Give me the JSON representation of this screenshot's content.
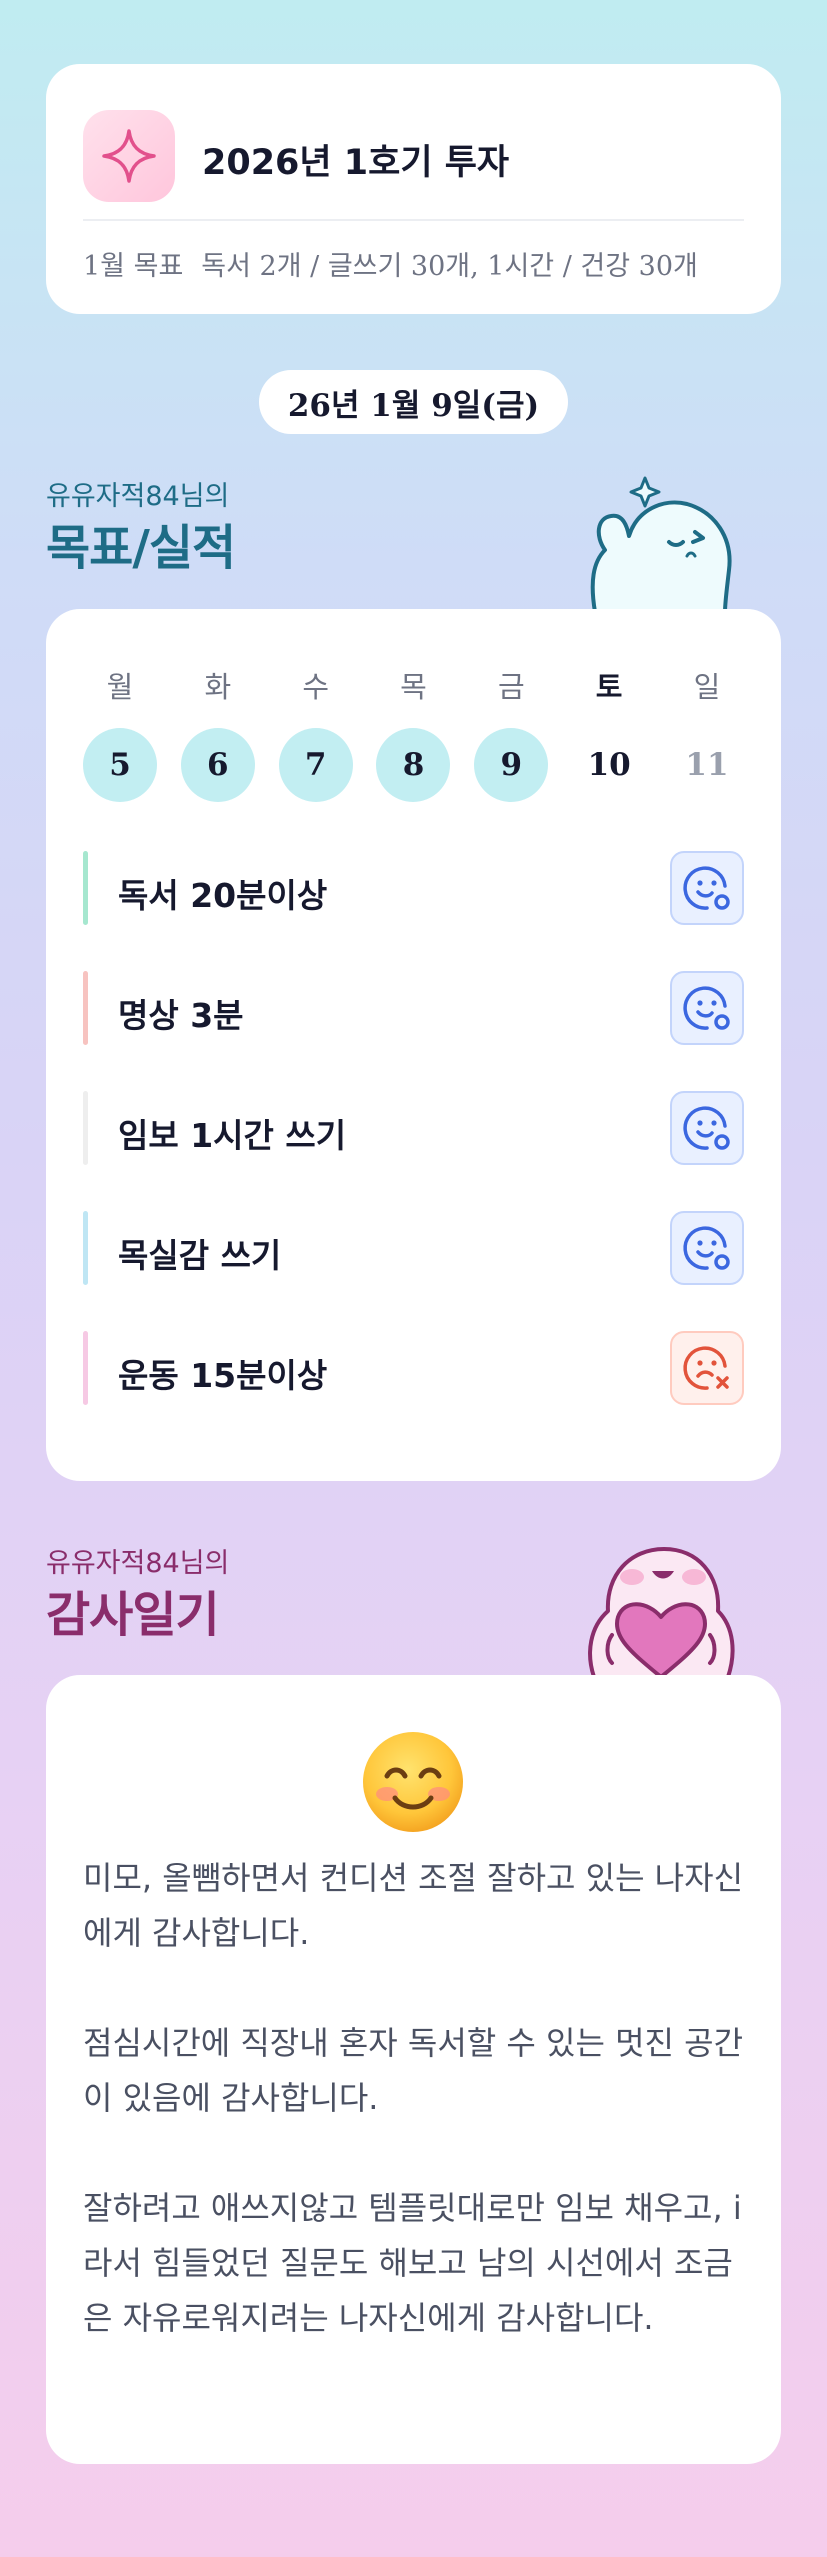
{
  "header": {
    "icon": "sparkle-icon",
    "title": "2026년 1호기 투자",
    "goal_label": "1월 목표",
    "goal_text": "독서 2개 / 글쓰기 30개, 1시간 / 건강 30개"
  },
  "date": "26년 1월 9일(금)",
  "goals_section": {
    "subtitle": "유유자적84님의",
    "title": "목표/실적",
    "weekdays": [
      "월",
      "화",
      "수",
      "목",
      "금",
      "토",
      "일"
    ],
    "days": [
      "5",
      "6",
      "7",
      "8",
      "9",
      "10",
      "11"
    ],
    "items": [
      {
        "label": "독서 20분이상",
        "color": "#a6e7cf",
        "status": "done"
      },
      {
        "label": "명상 3분",
        "color": "#f7c3c0",
        "status": "done"
      },
      {
        "label": "임보 1시간 쓰기",
        "color": "#eeeeee",
        "status": "done"
      },
      {
        "label": "목실감 쓰기",
        "color": "#bfe6f4",
        "status": "done"
      },
      {
        "label": "운동 15분이상",
        "color": "#f6c9e4",
        "status": "fail"
      }
    ]
  },
  "gratitude_section": {
    "subtitle": "유유자적84님의",
    "title": "감사일기",
    "emoji": "smiling-face-icon",
    "paragraphs": [
      "미모, 올뺌하면서 컨디션 조절 잘하고 있는 나자신에게 감사합니다.",
      "점심시간에 직장내 혼자 독서할 수 있는 멋진 공간이 있음에 감사합니다.",
      "잘하려고 애쓰지않고 템플릿대로만 임보 채우고, i라서 힘들었던 질문도 해보고 남의 시선에서 조금은 자유로워지려는 나자신에게 감사합니다."
    ]
  },
  "colors": {
    "goals_accent": "#1e6c86",
    "gratitude_accent": "#8a2d6b",
    "done_day": "#c2eef2",
    "status_ok": "#3b67e0",
    "status_fail": "#e2533b"
  }
}
